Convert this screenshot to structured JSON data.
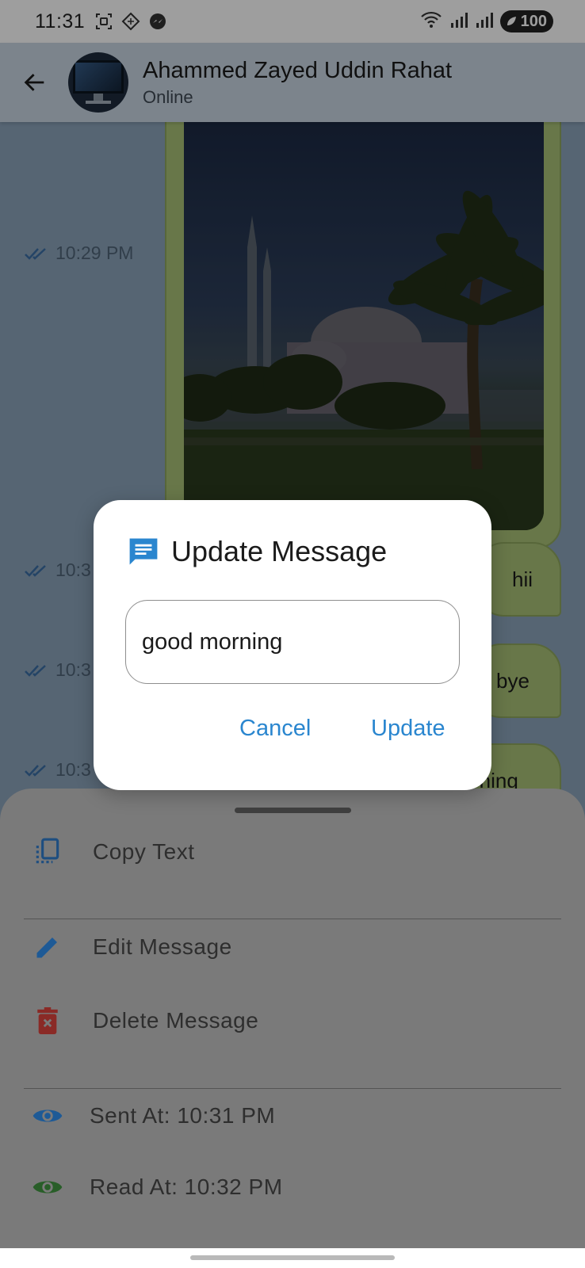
{
  "status_bar": {
    "time": "11:31",
    "battery": "100",
    "icons": [
      "screenshot-icon",
      "location-diamond-icon",
      "messenger-icon",
      "wifi-icon",
      "signal-icon",
      "signal-icon"
    ]
  },
  "app_bar": {
    "contact_name": "Ahammed Zayed Uddin Rahat",
    "contact_status": "Online"
  },
  "messages": [
    {
      "time": "10:29 PM",
      "type": "image"
    },
    {
      "time": "10:3",
      "text": "hii"
    },
    {
      "time": "10:3",
      "text": "bye"
    },
    {
      "time": "10:3",
      "text": "rning"
    }
  ],
  "dialog": {
    "title": "Update Message",
    "input_value": "good morning",
    "cancel_label": "Cancel",
    "update_label": "Update"
  },
  "sheet": {
    "items": [
      {
        "label": "Copy Text",
        "icon": "copy-icon"
      },
      {
        "label": "Edit Message",
        "icon": "pencil-icon"
      },
      {
        "label": "Delete Message",
        "icon": "trash-icon"
      },
      {
        "label": "Sent At: 10:31 PM",
        "icon": "eye-icon"
      },
      {
        "label": "Read At: 10:32 PM",
        "icon": "eye-icon"
      }
    ]
  },
  "colors": {
    "accent_blue": "#2a86cf",
    "bubble_green": "#a8c177",
    "delete_red": "#d73a34",
    "read_green": "#3f9a3f"
  }
}
